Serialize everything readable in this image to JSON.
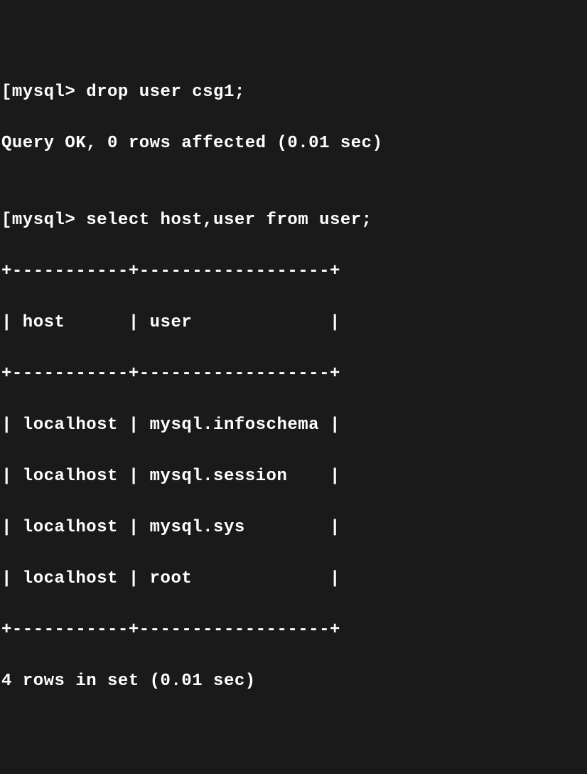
{
  "terminal": {
    "prompt1": "[mysql> ",
    "command1": "drop user csg1;",
    "result1": "Query OK, 0 rows affected (0.01 sec)",
    "blank": "",
    "prompt2": "[mysql> ",
    "command2": "select host,user from user;",
    "table": {
      "border_top": "+-----------+------------------+",
      "header": "| host      | user             |",
      "border_mid": "+-----------+------------------+",
      "rows": [
        "| localhost | mysql.infoschema |",
        "| localhost | mysql.session    |",
        "| localhost | mysql.sys        |",
        "| localhost | root             |"
      ],
      "border_bot": "+-----------+------------------+"
    },
    "result2": "4 rows in set (0.01 sec)"
  },
  "chart_data": {
    "type": "table",
    "columns": [
      "host",
      "user"
    ],
    "rows": [
      [
        "localhost",
        "mysql.infoschema"
      ],
      [
        "localhost",
        "mysql.session"
      ],
      [
        "localhost",
        "mysql.sys"
      ],
      [
        "localhost",
        "root"
      ]
    ],
    "row_count": 4,
    "time_sec": 0.01
  }
}
